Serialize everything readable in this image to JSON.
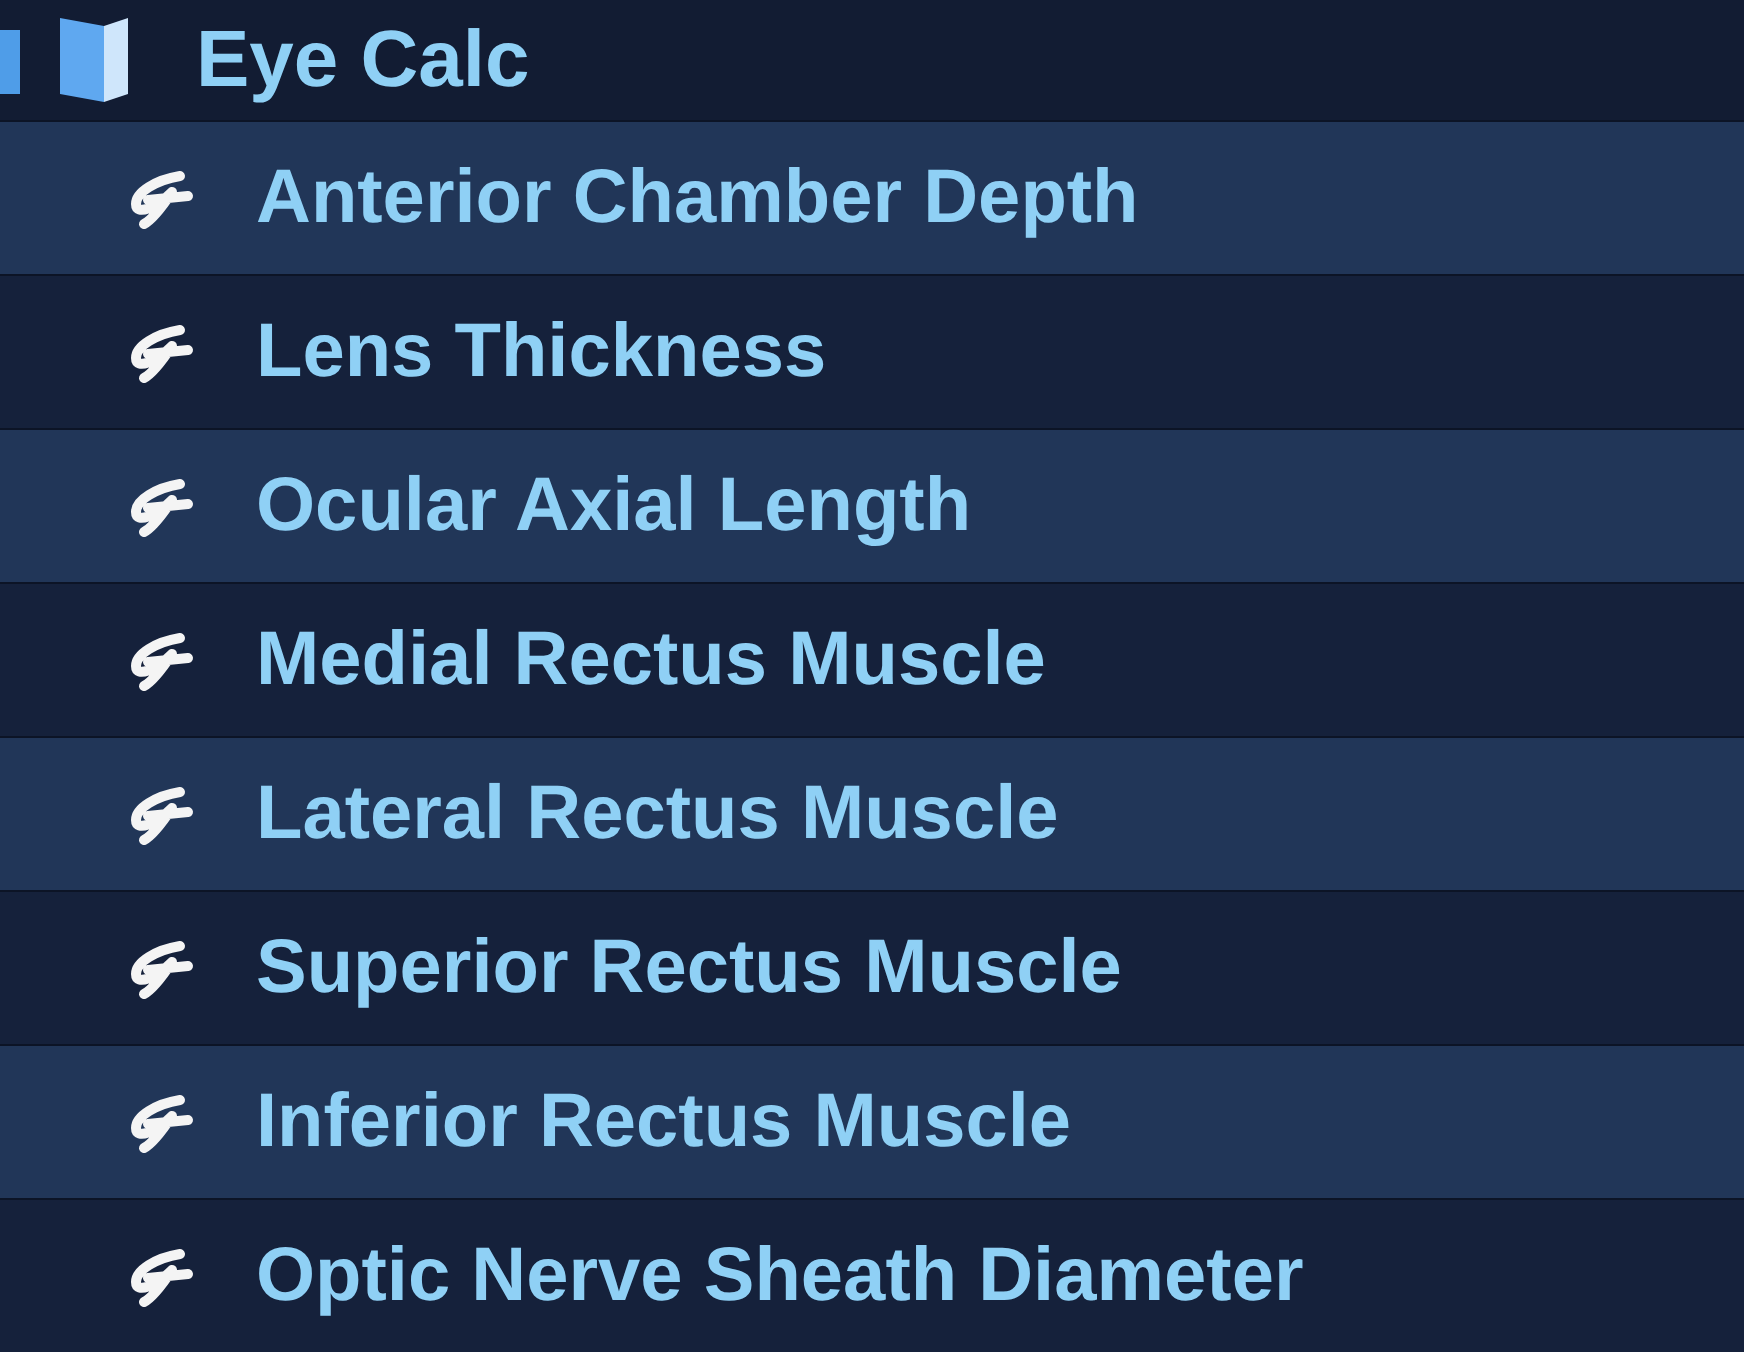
{
  "folder": {
    "title": "Eye Calc",
    "expanded": true
  },
  "items": [
    {
      "label": "Anterior Chamber Depth"
    },
    {
      "label": "Lens Thickness"
    },
    {
      "label": "Ocular Axial Length"
    },
    {
      "label": "Medial Rectus Muscle"
    },
    {
      "label": "Lateral Rectus Muscle"
    },
    {
      "label": "Superior Rectus Muscle"
    },
    {
      "label": "Inferior Rectus Muscle"
    },
    {
      "label": "Optic Nerve Sheath Diameter"
    }
  ]
}
